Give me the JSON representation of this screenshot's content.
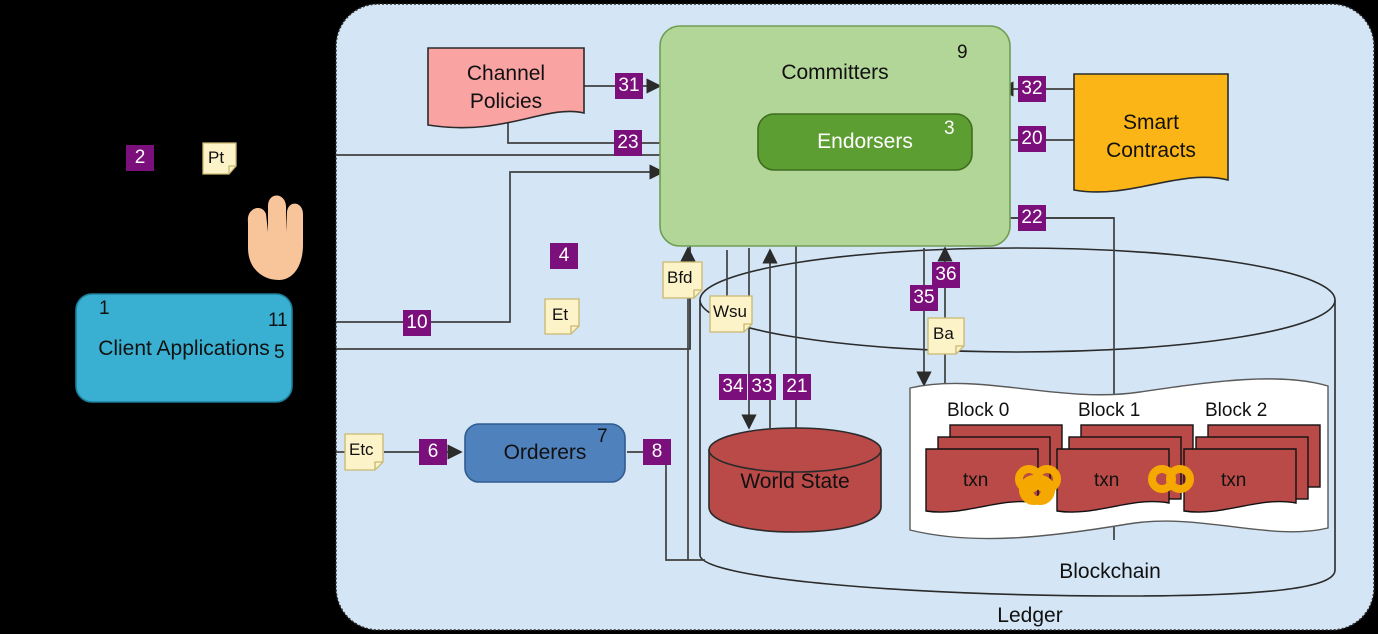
{
  "diagram": {
    "title_hidden": "Hyperledger Fabric Architecture",
    "container": {
      "name": "fabric-network-container",
      "fill": "#d4e6f6"
    },
    "nodes": {
      "client_applications": {
        "label": "Client Applications",
        "num_left": "1",
        "num_right_top": "11",
        "num_right_bottom": "5",
        "color": "#39b0d2"
      },
      "channel_policies": {
        "label_line1": "Channel",
        "label_line2": "Policies",
        "color": "#f9a3a3"
      },
      "committers": {
        "label": "Committers",
        "num": "9",
        "color": "#b2d698"
      },
      "endorsers": {
        "label": "Endorsers",
        "num": "3",
        "color": "#5c9e31"
      },
      "smart_contracts": {
        "label_line1": "Smart",
        "label_line2": "Contracts",
        "color": "#fbb516"
      },
      "orderers": {
        "label": "Orderers",
        "num": "7",
        "color": "#4f81bd"
      },
      "world_state": {
        "label": "World State",
        "color": "#b94a48"
      },
      "ledger": {
        "label": "Ledger"
      },
      "blockchain": {
        "label": "Blockchain"
      }
    },
    "blocks": [
      {
        "label": "Block 0",
        "txn": "txn"
      },
      {
        "label": "Block 1",
        "txn": "txn"
      },
      {
        "label": "Block 2",
        "txn": "txn"
      }
    ],
    "chain_links": [
      "chain-link-0-1",
      "chain-link-1-2"
    ],
    "sticky_notes": [
      {
        "id": "pt",
        "text": "Pt"
      },
      {
        "id": "et",
        "text": "Et"
      },
      {
        "id": "etc",
        "text": "Etc"
      },
      {
        "id": "bfd",
        "text": "Bfd"
      },
      {
        "id": "wsu",
        "text": "Wsu"
      },
      {
        "id": "ba",
        "text": "Ba"
      }
    ],
    "step_badges": [
      {
        "id": "b2",
        "text": "2"
      },
      {
        "id": "b31",
        "text": "31"
      },
      {
        "id": "b23",
        "text": "23"
      },
      {
        "id": "b32",
        "text": "32"
      },
      {
        "id": "b20",
        "text": "20"
      },
      {
        "id": "b22",
        "text": "22"
      },
      {
        "id": "b4",
        "text": "4"
      },
      {
        "id": "b10",
        "text": "10"
      },
      {
        "id": "b6",
        "text": "6"
      },
      {
        "id": "b8",
        "text": "8"
      },
      {
        "id": "b34",
        "text": "34"
      },
      {
        "id": "b33",
        "text": "33"
      },
      {
        "id": "b21",
        "text": "21"
      },
      {
        "id": "b35",
        "text": "35"
      },
      {
        "id": "b36",
        "text": "36"
      }
    ],
    "cursor": {
      "name": "pointing-hand-cursor",
      "color": "#f8c49a"
    },
    "colors": {
      "badge_bg": "#7b0f7b",
      "badge_fg": "#ffffff",
      "note_bg": "#fdf3c8",
      "note_border": "#c9b870",
      "line": "#3f3f3f",
      "background": "#000000"
    }
  }
}
